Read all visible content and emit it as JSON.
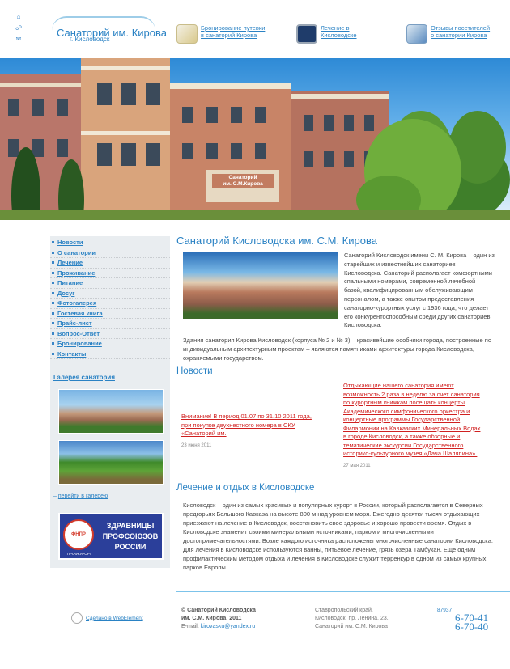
{
  "header": {
    "icons": [
      "home-icon",
      "sitemap-icon",
      "mail-icon"
    ],
    "logo_title": "Санаторий им. Кирова",
    "logo_subtitle": "г. Кисловодск",
    "links": [
      {
        "line1": "Бронирование путевки",
        "line2": "в санаторий Кирова",
        "icon": "voucher-icon"
      },
      {
        "line1": "Лечение в",
        "line2": "Кисловодске",
        "icon": "monitor-icon"
      },
      {
        "line1": "Отзывы посетителей",
        "line2": "о санатории Кирова",
        "icon": "reviews-icon"
      }
    ],
    "building_sign_line1": "Санаторий",
    "building_sign_line2": "им. С.М.Кирова"
  },
  "sidebar": {
    "menu": [
      "Новости",
      "О санатории",
      "Лечение",
      "Проживание",
      "Питание",
      "Досуг",
      "Фотогалерея",
      "Гостевая книга",
      "Прайс-лист",
      "Вопрос-Ответ",
      "Бронирование",
      "Контакты"
    ],
    "gallery_title": "Галерея санатория",
    "gallery_prefix": "– ",
    "gallery_link": "перейти в галерею",
    "ad": {
      "logo_text": "ФНПР",
      "logo_ring": "ПРОФКУРОРТ",
      "text": "ЗДРАВНИЦЫ ПРОФСОЮЗОВ РОССИИ"
    }
  },
  "main": {
    "title": "Санаторий Кисловодска им. С.М. Кирова",
    "lead": "Санаторий Кисловодск имени С. М. Кирова – один из старейших и известнейших санаториев Кисловодска. Санаторий располагает комфортными спальными номерами, современной лечебной базой, квалифицированным обслуживающим персоналом, а также опытом предоставления санаторно-курортных услуг с 1936 года, что делает его конкурентоспособным среди других санаториев Кисловодска.",
    "para2": "Здания санатория Кирова Кисловодск (корпуса № 2 и № 3) – красивейшие особняки города, построенные по индивидуальным архитектурным проектам – являются памятниками архитектуры города Кисловодска, охраняемыми государством.",
    "news_title": "Новости",
    "news": [
      {
        "text": "Внимание! В период 01.07 по 31.10 2011 года, при покупке двухнестного номера в СКУ «Санаторий им.",
        "date": "23 июня 2011"
      },
      {
        "text": "Отдыхающие нашего санатория имеют возможность 2 раза в неделю за счет санатория по курортным книжкам посещать концерты Академического симфонического оркестра и концертные программы Государственной Филармонии на Кавказских Минеральных Водах в городе Кисловодск, а также обзорные и тематические экскурсии Государственного историко-культурного музея «Дача Шаляпина».",
        "date": "27 мая 2011"
      }
    ],
    "section3_title": "Лечение и отдых в Кисловодске",
    "para3": "Кисловодск – один из самых красивых и популярных курорт в России, который располагается в Северных предгорьях Большого Кавказа на высоте 800 м над уровнем моря. Ежегодно десятки тысяч отдыхающих приезжают на лечение в Кисловодск, восстановить свое здоровье и хорошо провести время. Отдых в Кисловодске знаменит своими минеральными источниками, парком и многочисленными достопримечательностями. Возле каждого источника расположены многочисленные санатории Кисловодска. Для лечения в Кисловодске используются ванны, питьевое лечение, грязь озера Тамбукан. Еще одним профилактическим методом отдыха и лечения в Кисловодске служит терренкур в одном из самых крупных парков Европы..."
  },
  "footer": {
    "made_by": "Сделано в WebElement",
    "copyright_line1": "© Санаторий Кисловодска",
    "copyright_line2": "им. С.М. Кирова. 2011",
    "email_label": "E-mail:",
    "email": "kirovasku@yandex.ru",
    "address_line1": "Ставропольский край,",
    "address_line2": "Кисловодск, пр. Ленина, 23.",
    "address_line3": "Санаторий им. С.М. Кирова",
    "phone_code": "87937",
    "phone1": "6-70-41",
    "phone2": "6-70-40"
  },
  "colors": {
    "link": "#2a82c4",
    "news_link": "#d02020",
    "sidebar_bg": "#e9edf0",
    "ad_bg": "#2b3f9a"
  }
}
